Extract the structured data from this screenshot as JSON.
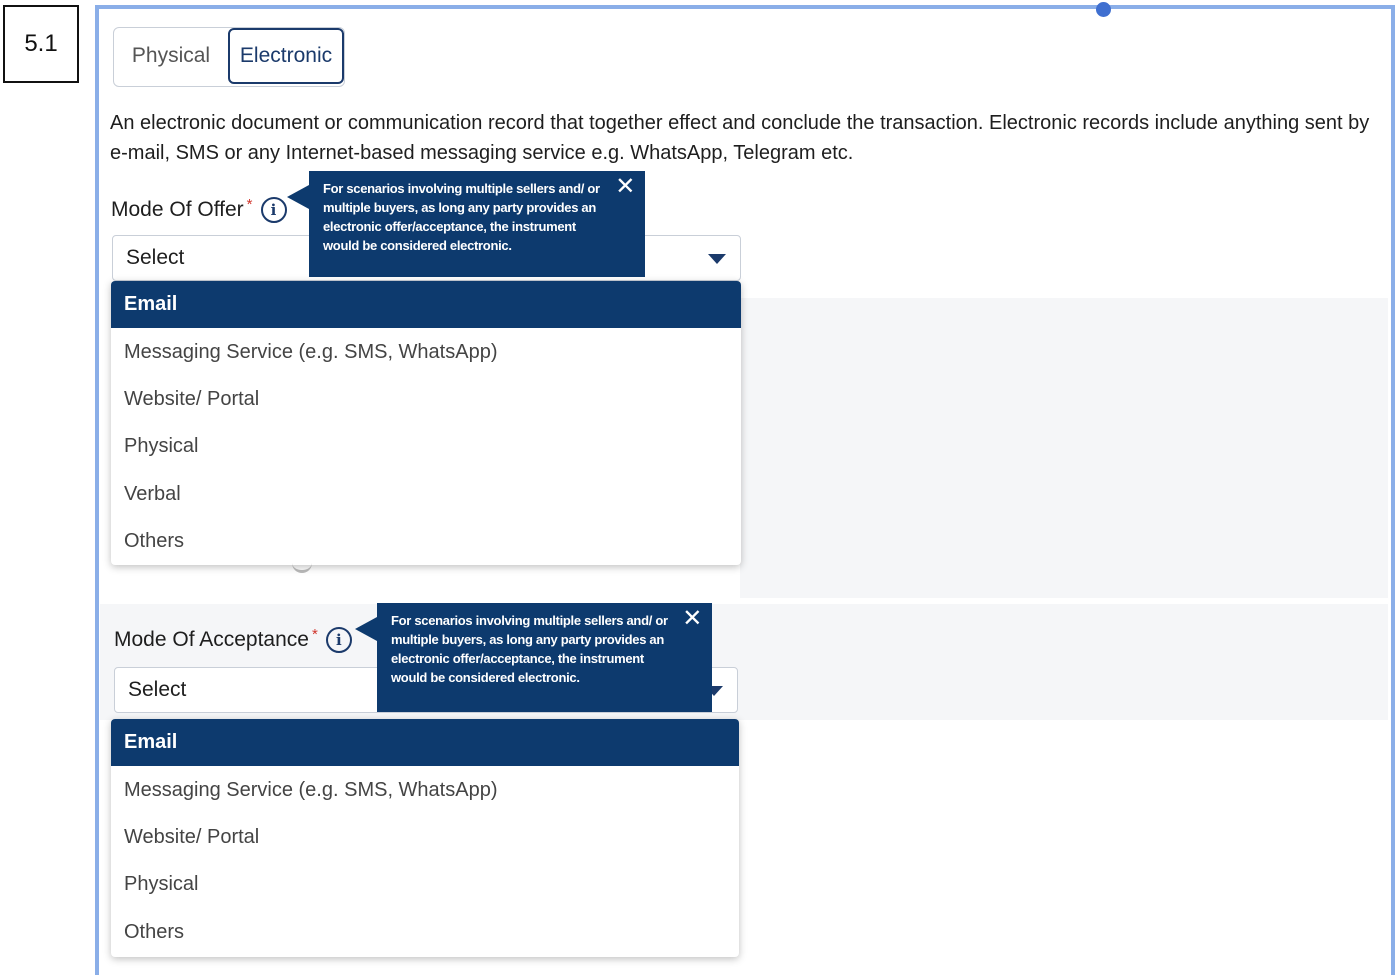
{
  "step_label": "5.1",
  "toggle": {
    "options": [
      "Physical",
      "Electronic"
    ],
    "selected": "Electronic"
  },
  "description": "An electronic document or communication record that together effect and conclude the transaction. Electronic records include anything sent by e-mail, SMS or any Internet-based messaging service e.g. WhatsApp, Telegram etc.",
  "offer": {
    "label": "Mode Of Offer",
    "required_mark": "*",
    "info_icon": "i",
    "select_value": "Select",
    "tooltip": "For scenarios involving multiple sellers and/ or multiple buyers, as long any party provides an electronic offer/acceptance, the instrument would be considered electronic.",
    "tooltip_close": "✕",
    "options": [
      "Email",
      "Messaging Service (e.g. SMS, WhatsApp)",
      "Website/ Portal",
      "Physical",
      "Verbal",
      "Others"
    ],
    "highlighted": "Email"
  },
  "acceptance": {
    "label": "Mode Of Acceptance",
    "required_mark": "*",
    "info_icon": "i",
    "select_value": "Select",
    "tooltip": "For scenarios involving multiple sellers and/ or multiple buyers, as long any party provides an electronic offer/acceptance, the instrument would be considered electronic.",
    "tooltip_close": "✕",
    "options": [
      "Email",
      "Messaging Service (e.g. SMS, WhatsApp)",
      "Website/ Portal",
      "Physical",
      "Others"
    ],
    "highlighted": "Email"
  },
  "colors": {
    "primary": "#0d3a6e",
    "frame": "#8aaee8",
    "required": "#d0342c"
  }
}
